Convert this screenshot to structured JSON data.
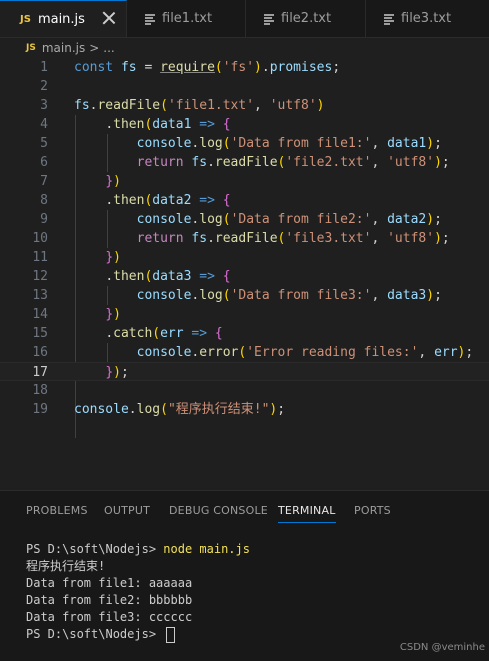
{
  "tabs": [
    {
      "label": "main.js",
      "icon": "js-file-icon",
      "badge": "JS",
      "active": true
    },
    {
      "label": "file1.txt",
      "icon": "text-file-icon"
    },
    {
      "label": "file2.txt",
      "icon": "text-file-icon"
    },
    {
      "label": "file3.txt",
      "icon": "text-file-icon"
    }
  ],
  "breadcrumb": {
    "badge": "JS",
    "file": "main.js",
    "sep": ">",
    "more": "..."
  },
  "editor": {
    "current_line": 17,
    "line_numbers": [
      "1",
      "2",
      "3",
      "4",
      "5",
      "6",
      "7",
      "8",
      "9",
      "10",
      "11",
      "12",
      "13",
      "14",
      "15",
      "16",
      "17",
      "18",
      "19"
    ]
  },
  "panel": {
    "tabs": [
      "PROBLEMS",
      "OUTPUT",
      "DEBUG CONSOLE",
      "TERMINAL",
      "PORTS"
    ],
    "active_tab": "TERMINAL"
  },
  "terminal": {
    "prompt": "PS D:\\soft\\Nodejs> ",
    "command": "node main.js",
    "output": [
      "程序执行结束!",
      "Data from file1: aaaaaa",
      "Data from file2: bbbbbb",
      "Data from file3: cccccc"
    ],
    "final_prompt": "PS D:\\soft\\Nodejs> "
  },
  "watermark": "CSDN @veminhe"
}
